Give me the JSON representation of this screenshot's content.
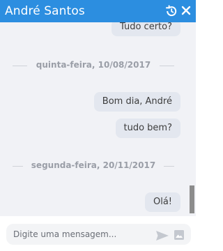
{
  "header": {
    "title": "André Santos",
    "history_icon": "history-icon",
    "close_icon": "close-icon",
    "background": "#2c8ee0"
  },
  "messages": [
    {
      "type": "bubble",
      "text": "Tudo certo?"
    },
    {
      "type": "divider",
      "text": "quinta-feira, 10/08/2017"
    },
    {
      "type": "bubble",
      "text": "Bom dia, André"
    },
    {
      "type": "bubble",
      "text": "tudo bem?"
    },
    {
      "type": "divider",
      "text": "segunda-feira, 20/11/2017"
    },
    {
      "type": "bubble",
      "text": "Olá!"
    }
  ],
  "composer": {
    "placeholder": "Digite uma mensagem...",
    "value": "",
    "send_icon": "send-icon",
    "attach_icon": "image-icon"
  }
}
